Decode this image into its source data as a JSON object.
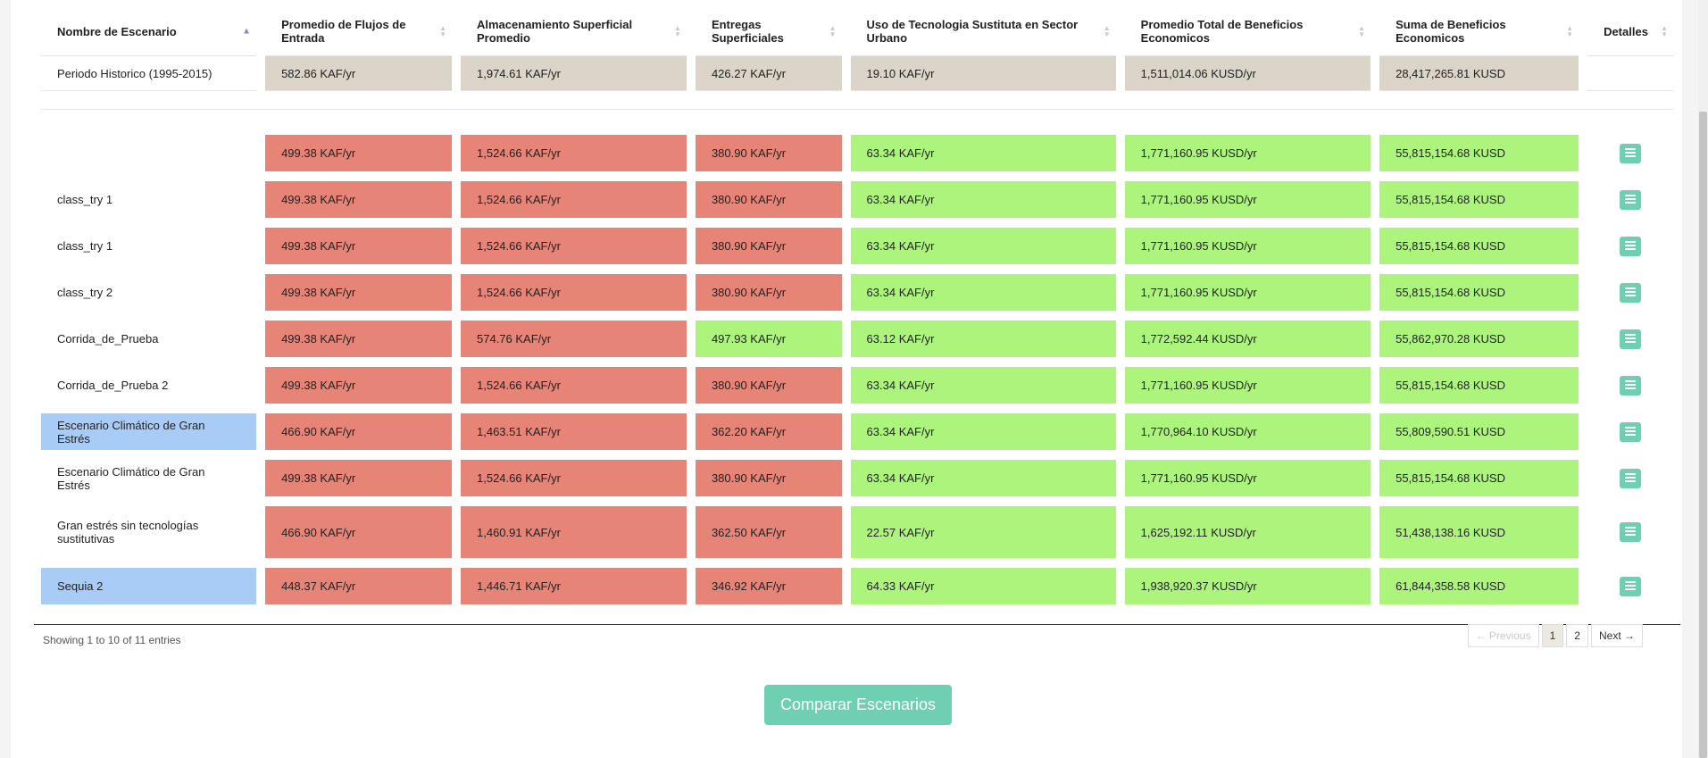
{
  "columns": [
    "Nombre de Escenario",
    "Promedio de Flujos de Entrada",
    "Almacenamiento Superficial Promedio",
    "Entregas Superficiales",
    "Uso de Tecnologia Sustituta en Sector Urbano",
    "Promedio Total de Beneficios Economicos",
    "Suma de Beneficios Economicos",
    "Detalles"
  ],
  "historical": {
    "name": "Periodo Historico (1995-2015)",
    "values": [
      "582.86 KAF/yr",
      "1,974.61 KAF/yr",
      "426.27 KAF/yr",
      "19.10 KAF/yr",
      "1,511,014.06 KUSD/yr",
      "28,417,265.81 KUSD"
    ]
  },
  "rows": [
    {
      "name": "",
      "v": [
        "499.38 KAF/yr",
        "1,524.66 KAF/yr",
        "380.90 KAF/yr",
        "63.34 KAF/yr",
        "1,771,160.95 KUSD/yr",
        "55,815,154.68 KUSD"
      ]
    },
    {
      "name": "class_try 1",
      "v": [
        "499.38 KAF/yr",
        "1,524.66 KAF/yr",
        "380.90 KAF/yr",
        "63.34 KAF/yr",
        "1,771,160.95 KUSD/yr",
        "55,815,154.68 KUSD"
      ]
    },
    {
      "name": "class_try 1",
      "v": [
        "499.38 KAF/yr",
        "1,524.66 KAF/yr",
        "380.90 KAF/yr",
        "63.34 KAF/yr",
        "1,771,160.95 KUSD/yr",
        "55,815,154.68 KUSD"
      ]
    },
    {
      "name": "class_try 2",
      "v": [
        "499.38 KAF/yr",
        "1,524.66 KAF/yr",
        "380.90 KAF/yr",
        "63.34 KAF/yr",
        "1,771,160.95 KUSD/yr",
        "55,815,154.68 KUSD"
      ]
    },
    {
      "name": "Corrida_de_Prueba",
      "v": [
        "499.38 KAF/yr",
        "574.76 KAF/yr",
        "497.93 KAF/yr",
        "63.12 KAF/yr",
        "1,772,592.44 KUSD/yr",
        "55,862,970.28 KUSD"
      ]
    },
    {
      "name": "Corrida_de_Prueba 2",
      "v": [
        "499.38 KAF/yr",
        "1,524.66 KAF/yr",
        "380.90 KAF/yr",
        "63.34 KAF/yr",
        "1,771,160.95 KUSD/yr",
        "55,815,154.68 KUSD"
      ]
    },
    {
      "name": "Escenario Climático de Gran Estrés",
      "v": [
        "466.90 KAF/yr",
        "1,463.51 KAF/yr",
        "362.20 KAF/yr",
        "63.34 KAF/yr",
        "1,770,964.10 KUSD/yr",
        "55,809,590.51 KUSD"
      ]
    },
    {
      "name": "Escenario Climático de Gran Estrés",
      "v": [
        "499.38 KAF/yr",
        "1,524.66 KAF/yr",
        "380.90 KAF/yr",
        "63.34 KAF/yr",
        "1,771,160.95 KUSD/yr",
        "55,815,154.68 KUSD"
      ]
    },
    {
      "name": "Gran estrés sin tecnologías sustitutivas",
      "v": [
        "466.90 KAF/yr",
        "1,460.91 KAF/yr",
        "362.50 KAF/yr",
        "22.57 KAF/yr",
        "1,625,192.11 KUSD/yr",
        "51,438,138.16 KUSD"
      ]
    },
    {
      "name": "Sequia 2",
      "v": [
        "448.37 KAF/yr",
        "1,446.71 KAF/yr",
        "346.92 KAF/yr",
        "64.33 KAF/yr",
        "1,938,920.37 KUSD/yr",
        "61,844,358.58 KUSD"
      ]
    }
  ],
  "colors": {
    "worse": "#e68477",
    "better": "#adf47d",
    "selected": "#a8ccf6",
    "historical": "#dbd4c8",
    "accent": "#6fcfb1"
  },
  "icons": {
    "sort_active": "sort-asc-icon",
    "sort": "sort-both-icon",
    "details": "list-icon"
  },
  "info": "Showing 1 to 10 of 11 entries",
  "pagination": {
    "previous": "← Previous",
    "pages": [
      "1",
      "2"
    ],
    "next": "Next →",
    "current": "1"
  },
  "compare_button": "Comparar Escenarios"
}
